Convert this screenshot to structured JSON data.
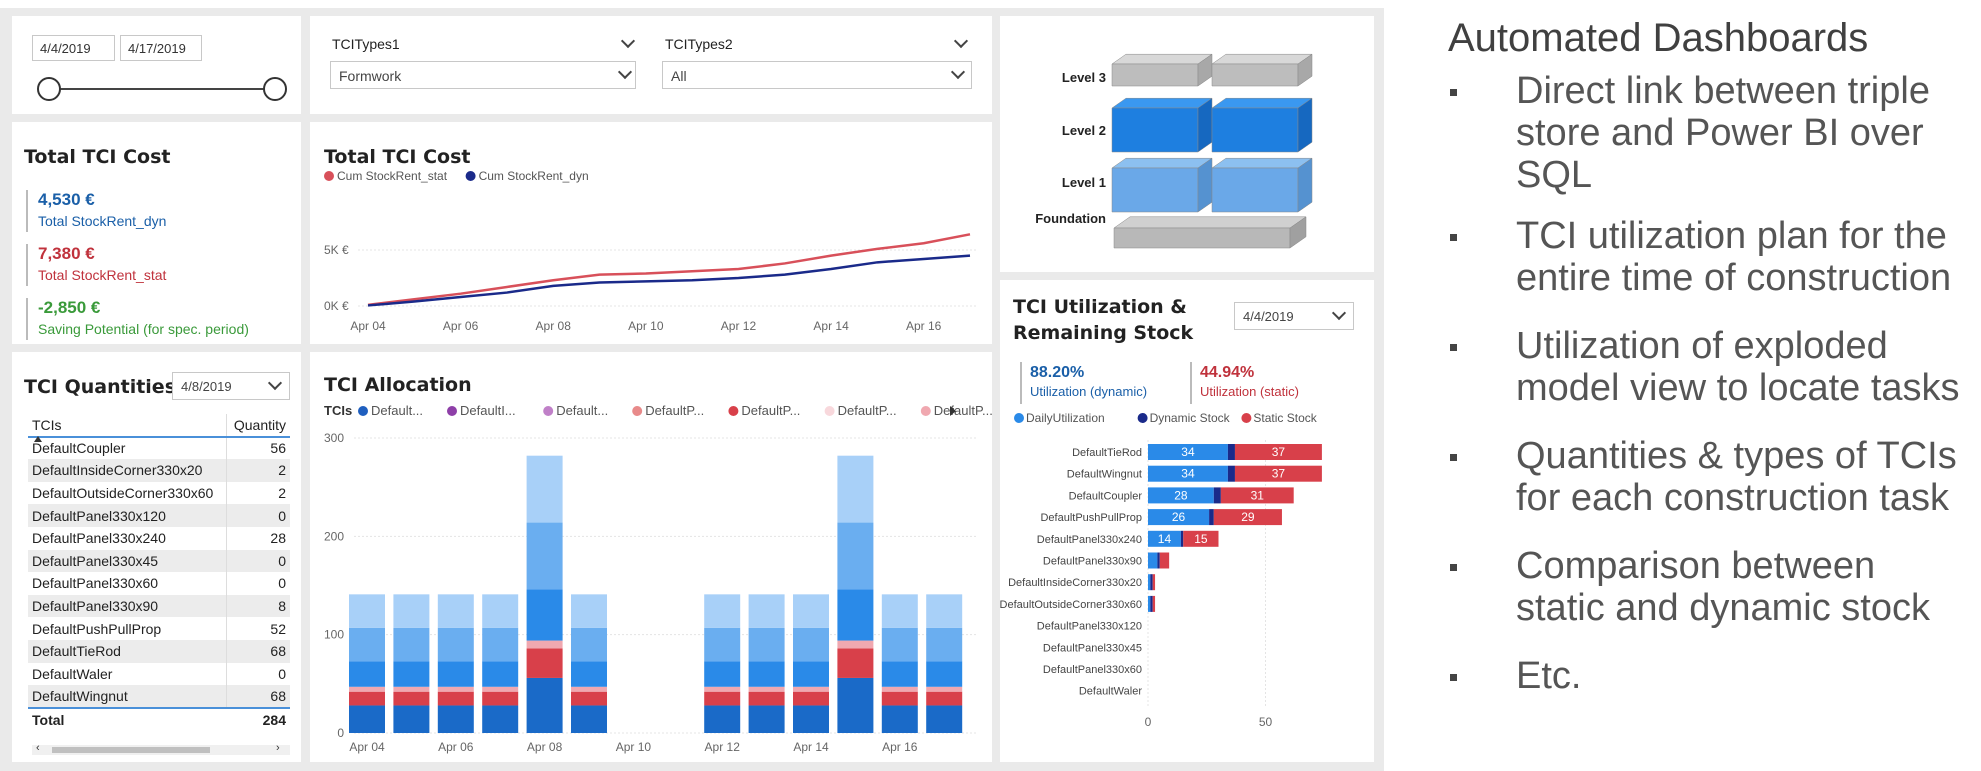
{
  "date_slicer": {
    "start": "4/4/2019",
    "end": "4/17/2019"
  },
  "type_slicers": [
    {
      "label": "TCITypes1",
      "value": "Formwork"
    },
    {
      "label": "TCITypes2",
      "value": "All"
    }
  ],
  "kpi": {
    "title": "Total TCI Cost",
    "items": [
      {
        "value": "4,530 €",
        "label": "Total StockRent_dyn",
        "color": "#1a5fa8"
      },
      {
        "value": "7,380 €",
        "label": "Total StockRent_stat",
        "color": "#c0323c"
      },
      {
        "value": "-2,850 €",
        "label": "Saving Potential (for spec. period)",
        "color": "#3a9a3a"
      }
    ]
  },
  "cost_chart": {
    "title": "Total TCI Cost",
    "legend": [
      {
        "name": "Cum StockRent_stat",
        "color": "#d8505a"
      },
      {
        "name": "Cum StockRent_dyn",
        "color": "#1a2a8a"
      }
    ],
    "y_ticks": [
      "5K €",
      "0K €"
    ],
    "x_ticks": [
      "Apr 04",
      "Apr 06",
      "Apr 08",
      "Apr 10",
      "Apr 12",
      "Apr 14",
      "Apr 16"
    ]
  },
  "quantities": {
    "title": "TCI Quantities",
    "date": "4/8/2019",
    "col_tcis": "TCIs",
    "col_qty": "Quantity",
    "rows": [
      {
        "name": "DefaultCoupler",
        "qty": "56"
      },
      {
        "name": "DefaultInsideCorner330x20",
        "qty": "2"
      },
      {
        "name": "DefaultOutsideCorner330x60",
        "qty": "2"
      },
      {
        "name": "DefaultPanel330x120",
        "qty": "0"
      },
      {
        "name": "DefaultPanel330x240",
        "qty": "28"
      },
      {
        "name": "DefaultPanel330x45",
        "qty": "0"
      },
      {
        "name": "DefaultPanel330x60",
        "qty": "0"
      },
      {
        "name": "DefaultPanel330x90",
        "qty": "8"
      },
      {
        "name": "DefaultPushPullProp",
        "qty": "52"
      },
      {
        "name": "DefaultTieRod",
        "qty": "68"
      },
      {
        "name": "DefaultWaler",
        "qty": "0"
      },
      {
        "name": "DefaultWingnut",
        "qty": "68"
      }
    ],
    "total_label": "Total",
    "total_value": "284"
  },
  "allocation": {
    "title": "TCI Allocation",
    "legend_title": "TCIs",
    "legend": [
      {
        "name": "Default...",
        "color": "#1f5fbf"
      },
      {
        "name": "DefaultI...",
        "color": "#8e3fa8"
      },
      {
        "name": "Default...",
        "color": "#c080c8"
      },
      {
        "name": "DefaultP...",
        "color": "#e88a8a"
      },
      {
        "name": "DefaultP...",
        "color": "#d8404a"
      },
      {
        "name": "DefaultP...",
        "color": "#f8d8dc"
      },
      {
        "name": "DefaultP...",
        "color": "#f0a8b0"
      }
    ],
    "y_ticks": [
      "300",
      "200",
      "100",
      "0"
    ],
    "x_ticks": [
      "Apr 04",
      "Apr 06",
      "Apr 08",
      "Apr 10",
      "Apr 12",
      "Apr 14",
      "Apr 16"
    ]
  },
  "model": {
    "levels": [
      "Level 3",
      "Level 2",
      "Level 1",
      "Foundation"
    ]
  },
  "utilization": {
    "title_line1": "TCI Utilization &",
    "title_line2": "Remaining Stock",
    "date": "4/4/2019",
    "kpi_dyn": {
      "value": "88.20%",
      "label": "Utilization (dynamic)",
      "color": "#1a5fa8"
    },
    "kpi_stat": {
      "value": "44.94%",
      "label": "Utilization (static)",
      "color": "#c0323c"
    },
    "legend": [
      {
        "name": "DailyUtilization",
        "color": "#2a8ae8"
      },
      {
        "name": "Dynamic Stock",
        "color": "#1a2a8a"
      },
      {
        "name": "Static Stock",
        "color": "#d8404a"
      }
    ],
    "x_ticks": [
      "0",
      "50"
    ]
  },
  "chart_data": [
    {
      "type": "line",
      "title": "Total TCI Cost",
      "x": [
        "Apr 04",
        "Apr 05",
        "Apr 06",
        "Apr 07",
        "Apr 08",
        "Apr 09",
        "Apr 10",
        "Apr 11",
        "Apr 12",
        "Apr 13",
        "Apr 14",
        "Apr 15",
        "Apr 16",
        "Apr 17"
      ],
      "series": [
        {
          "name": "Cum StockRent_stat",
          "values": [
            0.1,
            0.6,
            1.1,
            1.7,
            2.3,
            2.8,
            2.9,
            3.1,
            3.3,
            3.8,
            4.5,
            5.1,
            5.6,
            6.4
          ]
        },
        {
          "name": "Cum StockRent_dyn",
          "values": [
            0.05,
            0.4,
            0.8,
            1.2,
            1.8,
            2.1,
            2.2,
            2.3,
            2.5,
            2.8,
            3.3,
            3.9,
            4.2,
            4.5
          ]
        }
      ],
      "y_ticks": [
        "0K €",
        "5K €"
      ]
    },
    {
      "type": "bar",
      "title": "TCI Allocation",
      "categories": [
        "Apr 04",
        "Apr 05",
        "Apr 06",
        "Apr 07",
        "Apr 08",
        "Apr 09",
        "Apr 10",
        "Apr 11",
        "Apr 12",
        "Apr 13",
        "Apr 14",
        "Apr 15",
        "Apr 16",
        "Apr 17"
      ],
      "stacked": true,
      "series": [
        {
          "color": "#1a6ac8",
          "values": [
            28,
            28,
            28,
            28,
            56,
            28,
            0,
            0,
            28,
            28,
            28,
            56,
            28,
            28
          ]
        },
        {
          "color": "#d8404a",
          "values": [
            14,
            14,
            14,
            14,
            30,
            14,
            0,
            0,
            14,
            14,
            14,
            30,
            14,
            14
          ]
        },
        {
          "color": "#f0a8b0",
          "values": [
            5,
            5,
            5,
            5,
            8,
            5,
            0,
            0,
            5,
            5,
            5,
            8,
            5,
            5
          ]
        },
        {
          "color": "#2a8ae8",
          "values": [
            26,
            26,
            26,
            26,
            52,
            26,
            0,
            0,
            26,
            26,
            26,
            52,
            26,
            26
          ]
        },
        {
          "color": "#6aaef0",
          "values": [
            34,
            34,
            34,
            34,
            68,
            34,
            0,
            0,
            34,
            34,
            34,
            68,
            34,
            34
          ]
        },
        {
          "color": "#a8d0f8",
          "values": [
            34,
            34,
            34,
            34,
            68,
            34,
            0,
            0,
            34,
            34,
            34,
            68,
            34,
            34
          ]
        }
      ],
      "ylim": [
        0,
        300
      ],
      "y_ticks": [
        0,
        100,
        200,
        300
      ]
    },
    {
      "type": "bar",
      "orientation": "horizontal",
      "title": "TCI Utilization & Remaining Stock",
      "categories": [
        "DefaultTieRod",
        "DefaultWingnut",
        "DefaultCoupler",
        "DefaultPushPullProp",
        "DefaultPanel330x240",
        "DefaultPanel330x90",
        "DefaultInsideCorner330x20",
        "DefaultOutsideCorner330x60",
        "DefaultPanel330x120",
        "DefaultPanel330x45",
        "DefaultPanel330x60",
        "DefaultWaler"
      ],
      "series": [
        {
          "name": "DailyUtilization",
          "values": [
            34,
            34,
            28,
            26,
            14,
            4,
            1,
            1,
            0,
            0,
            0,
            0
          ]
        },
        {
          "name": "Dynamic Stock",
          "values": [
            3,
            3,
            3,
            2,
            1,
            1,
            1,
            1,
            0,
            0,
            0,
            0
          ]
        },
        {
          "name": "Static Stock",
          "values": [
            37,
            37,
            31,
            29,
            15,
            4,
            1,
            1,
            0,
            0,
            0,
            0
          ]
        }
      ],
      "data_labels": {
        "DailyUtilization": [
          "34",
          "34",
          "28",
          "26",
          "14"
        ],
        "Static Stock": [
          "37",
          "37",
          "31",
          "29",
          "15"
        ]
      },
      "x_ticks": [
        0,
        50
      ]
    }
  ],
  "side": {
    "title": "Automated Dashboards",
    "bullets": [
      [
        "Direct link between triple",
        "store and Power BI over",
        "SQL"
      ],
      [
        "TCI utilization plan for the",
        "entire time of construction"
      ],
      [
        "Utilization of exploded",
        "model view to locate tasks"
      ],
      [
        "Quantities & types of TCIs",
        "for each construction task"
      ],
      [
        "Comparison between",
        "static and dynamic stock"
      ],
      [
        "Etc."
      ]
    ]
  }
}
